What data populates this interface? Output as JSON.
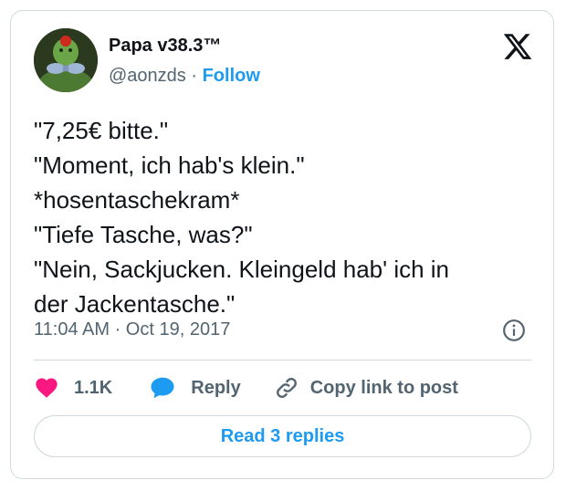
{
  "author": {
    "display_name": "Papa v38.3™",
    "handle": "@aonzds",
    "separator": "·",
    "follow_label": "Follow"
  },
  "post": {
    "lines": [
      "\"7,25€ bitte.\"",
      "\"Moment, ich hab's klein.\"",
      "*hosentaschekram*",
      "\"Tiefe Tasche, was?\"",
      "\"Nein, Sackjucken. Kleingeld hab' ich in",
      "der Jackentasche.\""
    ],
    "timestamp": "11:04 AM · Oct 19, 2017"
  },
  "actions": {
    "likes_count": "1.1K",
    "reply_label": "Reply",
    "copy_link_label": "Copy link to post"
  },
  "replies": {
    "read_label": "Read 3 replies"
  },
  "icons": {
    "brand": "x-logo-icon",
    "info": "info-icon",
    "like": "heart-icon",
    "reply": "speech-bubble-icon",
    "copy": "link-icon"
  },
  "colors": {
    "accent": "#1d9bf0",
    "heart": "#f91880",
    "text": "#0f1419",
    "muted": "#536471",
    "border": "#cfd9de"
  }
}
